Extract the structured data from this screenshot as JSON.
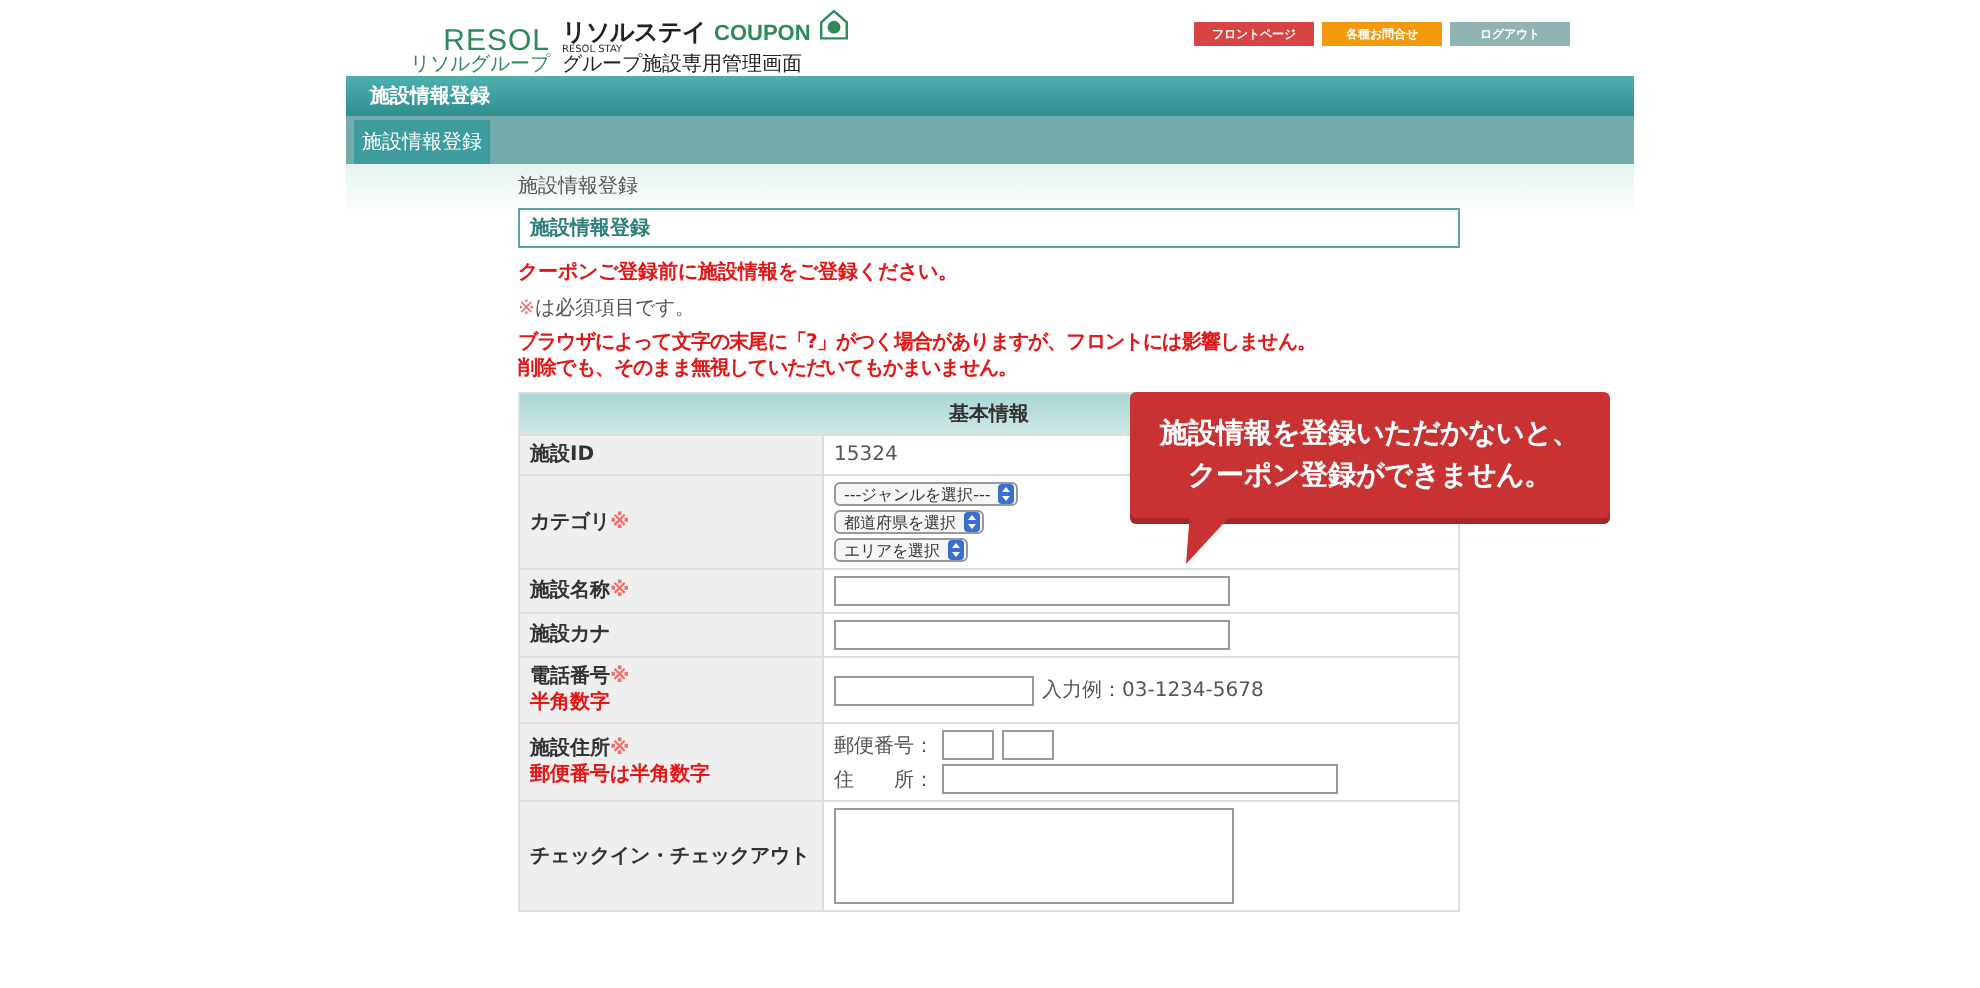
{
  "header": {
    "logo": {
      "brand": "RESOL",
      "brand_sub": "リソルグループ",
      "product_name": "リソルステイ",
      "product_tag": "COUPON",
      "product_sub": "RESOL STAY",
      "subtitle": "グループ施設専用管理画面"
    },
    "buttons": [
      {
        "label": "フロントページ",
        "kind": "front"
      },
      {
        "label": "各種お問合せ",
        "kind": "contact"
      },
      {
        "label": "ログアウト",
        "kind": "logout"
      }
    ]
  },
  "title_bar": "施設情報登録",
  "subnav": [
    {
      "label": "施設情報登録",
      "selected": true
    }
  ],
  "breadcrumb": "施設情報登録",
  "page_title": "施設情報登録",
  "notice": "クーポンご登録前に施設情報をご登録ください。",
  "required_note": {
    "mark": "※",
    "text": "は必須項目です。"
  },
  "warnings": [
    "ブラウザによって文字の末尾に「?」がつく場合がありますが、フロントには影響しません。",
    "削除でも、そのまま無視していただいてもかまいません。"
  ],
  "table": {
    "heading": "基本情報",
    "rows": [
      {
        "label": "施設ID",
        "kind": "static",
        "value": "15324"
      },
      {
        "label": "カテゴリ",
        "required_mark": "※",
        "kind": "selects",
        "options": [
          "---ジャンルを選択---",
          "都道府県を選択",
          "エリアを選択"
        ]
      },
      {
        "label": "施設名称",
        "required_mark": "※",
        "kind": "input"
      },
      {
        "label": "施設カナ",
        "kind": "input"
      },
      {
        "label": "電話番号",
        "required_mark": "※",
        "sub_label": "半角数字",
        "kind": "tel",
        "hint": "入力例：03-1234-5678"
      },
      {
        "label": "施設住所",
        "required_mark": "※",
        "sub_label": "郵便番号は半角数字",
        "kind": "address",
        "zip_label": "郵便番号：",
        "address_label": "住　　所："
      },
      {
        "label": "チェックイン・チェックアウト",
        "kind": "textarea"
      }
    ]
  },
  "callout": {
    "lines": [
      "施設情報を登録いただかないと、",
      "クーポン登録ができません。"
    ]
  }
}
